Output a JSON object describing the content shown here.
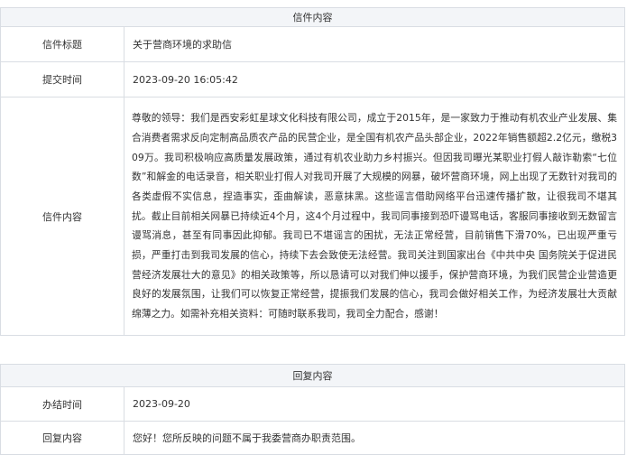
{
  "letter": {
    "section_title": "信件内容",
    "rows": {
      "title_label": "信件标题",
      "title_value": "关于营商环境的求助信",
      "time_label": "提交时间",
      "time_value": "2023-09-20 16:05:42",
      "content_label": "信件内容",
      "content_value": "尊敬的领导：我们是西安彩虹星球文化科技有限公司，成立于2015年，是一家致力于推动有机农业产业发展、集合消费者需求反向定制高品质农产品的民营企业，是全国有机农产品头部企业，2022年销售额超2.2亿元，缴税309万。我司积极响应高质量发展政策，通过有机农业助力乡村振兴。但因我司曝光某职业打假人敲诈勒索“七位数”和解金的电话录音，相关职业打假人对我司开展了大规模的网暴，破坏营商环境，网上出现了无数针对我司的各类虚假不实信息，捏造事实，歪曲解读，恶意抹黑。这些谣言借助网络平台迅速传播扩散，让很我司不堪其扰。截止目前相关网暴已持续近4个月，这4个月过程中，我司同事接到恐吓谩骂电话，客服同事接收到无数留言谩骂消息，甚至有同事因此抑郁。我司已不堪谣言的困扰，无法正常经营，目前销售下滑70%，已出现严重亏损，严重打击到我司发展的信心，持续下去会致使无法经营。我司关注到国家出台《中共中央 国务院关于促进民营经济发展壮大的意见》的相关政策等，所以恳请可以对我们伸以援手，保护营商环境，为我们民营企业营造更良好的发展氛围，让我们可以恢复正常经营，提振我们发展的信心，我司会做好相关工作，为经济发展壮大贡献绵薄之力。如需补充相关资料：可随时联系我司，我司全力配合，感谢！"
    }
  },
  "reply": {
    "section_title": "回复内容",
    "rows": {
      "date_label": "办结时间",
      "date_value": "2023-09-20",
      "content_label": "回复内容",
      "content_value": "您好！您所反映的问题不属于我委营商办职责范围。"
    }
  }
}
